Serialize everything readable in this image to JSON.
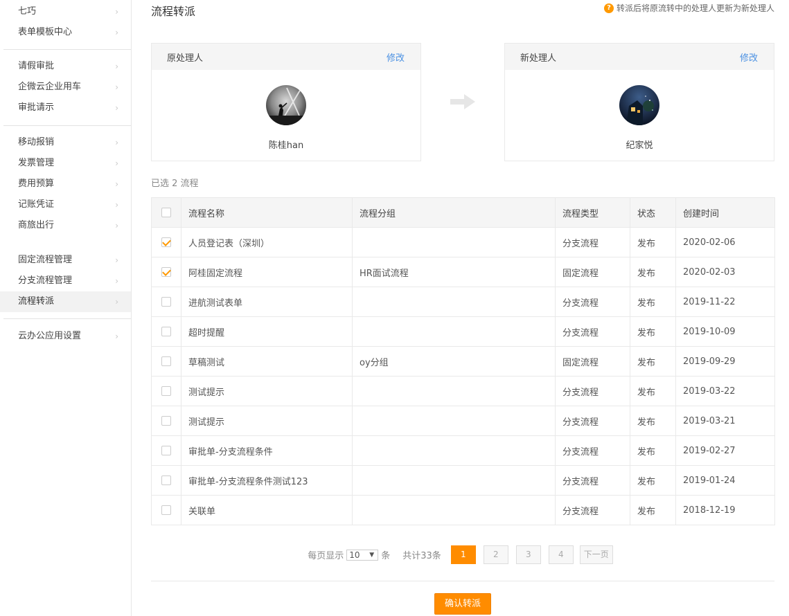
{
  "sidebar": {
    "items": [
      {
        "label": "七巧"
      },
      {
        "label": "表单模板中心"
      },
      {
        "label": "请假审批"
      },
      {
        "label": "企微云企业用车"
      },
      {
        "label": "审批请示"
      },
      {
        "label": "移动报销"
      },
      {
        "label": "发票管理"
      },
      {
        "label": "费用预算"
      },
      {
        "label": "记账凭证"
      },
      {
        "label": "商旅出行"
      },
      {
        "label": "固定流程管理"
      },
      {
        "label": "分支流程管理"
      },
      {
        "label": "流程转派"
      },
      {
        "label": "云办公应用设置"
      }
    ],
    "active": "流程转派"
  },
  "header": {
    "title": "流程转派",
    "tip": "转派后将原流转中的处理人更新为新处理人"
  },
  "original_handler": {
    "label": "原处理人",
    "edit": "修改",
    "name": "陈桂han"
  },
  "new_handler": {
    "label": "新处理人",
    "edit": "修改",
    "name": "纪家悦"
  },
  "selected_text": "已选 2 流程",
  "table": {
    "columns": [
      "流程名称",
      "流程分组",
      "流程类型",
      "状态",
      "创建时间"
    ],
    "rows": [
      {
        "checked": true,
        "name": "人员登记表（深圳）",
        "group": "",
        "type": "分支流程",
        "status": "发布",
        "date": "2020-02-06"
      },
      {
        "checked": true,
        "name": "阿桂固定流程",
        "group": "HR面试流程",
        "type": "固定流程",
        "status": "发布",
        "date": "2020-02-03"
      },
      {
        "checked": false,
        "name": "进航测试表单",
        "group": "",
        "type": "分支流程",
        "status": "发布",
        "date": "2019-11-22"
      },
      {
        "checked": false,
        "name": "超时提醒",
        "group": "",
        "type": "分支流程",
        "status": "发布",
        "date": "2019-10-09"
      },
      {
        "checked": false,
        "name": "草稿测试",
        "group": "oy分组",
        "type": "固定流程",
        "status": "发布",
        "date": "2019-09-29"
      },
      {
        "checked": false,
        "name": "测试提示",
        "group": "",
        "type": "分支流程",
        "status": "发布",
        "date": "2019-03-22"
      },
      {
        "checked": false,
        "name": "测试提示",
        "group": "",
        "type": "分支流程",
        "status": "发布",
        "date": "2019-03-21"
      },
      {
        "checked": false,
        "name": "审批单-分支流程条件",
        "group": "",
        "type": "分支流程",
        "status": "发布",
        "date": "2019-02-27"
      },
      {
        "checked": false,
        "name": "审批单-分支流程条件测试123",
        "group": "",
        "type": "分支流程",
        "status": "发布",
        "date": "2019-01-24"
      },
      {
        "checked": false,
        "name": "关联单",
        "group": "",
        "type": "分支流程",
        "status": "发布",
        "date": "2018-12-19"
      }
    ]
  },
  "pagination": {
    "per_page_label": "每页显示",
    "per_page_value": "10",
    "per_page_unit": "条",
    "total": "共计33条",
    "pages": [
      "1",
      "2",
      "3",
      "4"
    ],
    "current": "1",
    "next": "下一页"
  },
  "confirm_button": "确认转派",
  "colors": {
    "accent": "#ff8c00",
    "link": "#4a90e2"
  }
}
